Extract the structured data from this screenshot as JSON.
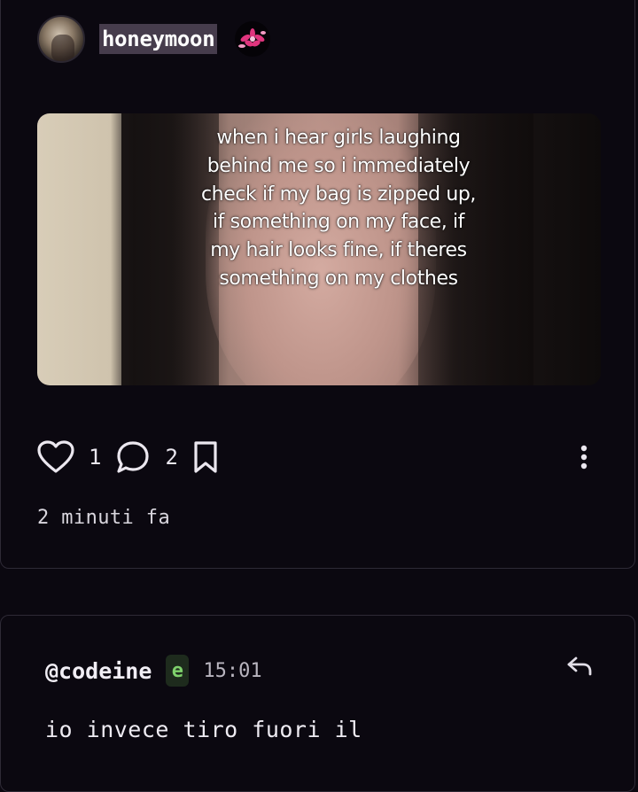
{
  "post": {
    "username": "honeymoon",
    "media_caption": "when i hear girls laughing behind me so i immediately check if my bag is zipped up, if something on my face, if my hair looks fine, if theres something on my clothes",
    "likes": "1",
    "comments": "2",
    "timestamp": "2 minuti fa",
    "icons": {
      "avatar": "avatar-photo",
      "badge": "flower-icon",
      "like": "heart-icon",
      "comment": "comment-bubble-icon",
      "save": "bookmark-icon",
      "more": "more-vertical-icon"
    }
  },
  "comment": {
    "username": "@codeine",
    "badge": "e",
    "time": "15:01",
    "text": "io invece tiro fuori il",
    "icons": {
      "reply": "reply-arrow-icon"
    }
  },
  "colors": {
    "background": "#0b0810",
    "border": "#2e2a36",
    "username_highlight": "#463c4c",
    "badge_green": "#7fd16c"
  }
}
